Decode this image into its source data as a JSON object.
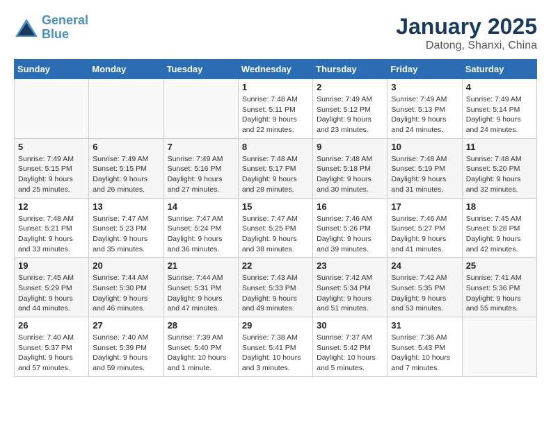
{
  "header": {
    "logo_line1": "General",
    "logo_line2": "Blue",
    "title": "January 2025",
    "subtitle": "Datong, Shanxi, China"
  },
  "weekdays": [
    "Sunday",
    "Monday",
    "Tuesday",
    "Wednesday",
    "Thursday",
    "Friday",
    "Saturday"
  ],
  "weeks": [
    [
      {
        "day": "",
        "content": ""
      },
      {
        "day": "",
        "content": ""
      },
      {
        "day": "",
        "content": ""
      },
      {
        "day": "1",
        "content": "Sunrise: 7:48 AM\nSunset: 5:11 PM\nDaylight: 9 hours and 22 minutes."
      },
      {
        "day": "2",
        "content": "Sunrise: 7:49 AM\nSunset: 5:12 PM\nDaylight: 9 hours and 23 minutes."
      },
      {
        "day": "3",
        "content": "Sunrise: 7:49 AM\nSunset: 5:13 PM\nDaylight: 9 hours and 24 minutes."
      },
      {
        "day": "4",
        "content": "Sunrise: 7:49 AM\nSunset: 5:14 PM\nDaylight: 9 hours and 24 minutes."
      }
    ],
    [
      {
        "day": "5",
        "content": "Sunrise: 7:49 AM\nSunset: 5:15 PM\nDaylight: 9 hours and 25 minutes."
      },
      {
        "day": "6",
        "content": "Sunrise: 7:49 AM\nSunset: 5:15 PM\nDaylight: 9 hours and 26 minutes."
      },
      {
        "day": "7",
        "content": "Sunrise: 7:49 AM\nSunset: 5:16 PM\nDaylight: 9 hours and 27 minutes."
      },
      {
        "day": "8",
        "content": "Sunrise: 7:48 AM\nSunset: 5:17 PM\nDaylight: 9 hours and 28 minutes."
      },
      {
        "day": "9",
        "content": "Sunrise: 7:48 AM\nSunset: 5:18 PM\nDaylight: 9 hours and 30 minutes."
      },
      {
        "day": "10",
        "content": "Sunrise: 7:48 AM\nSunset: 5:19 PM\nDaylight: 9 hours and 31 minutes."
      },
      {
        "day": "11",
        "content": "Sunrise: 7:48 AM\nSunset: 5:20 PM\nDaylight: 9 hours and 32 minutes."
      }
    ],
    [
      {
        "day": "12",
        "content": "Sunrise: 7:48 AM\nSunset: 5:21 PM\nDaylight: 9 hours and 33 minutes."
      },
      {
        "day": "13",
        "content": "Sunrise: 7:47 AM\nSunset: 5:23 PM\nDaylight: 9 hours and 35 minutes."
      },
      {
        "day": "14",
        "content": "Sunrise: 7:47 AM\nSunset: 5:24 PM\nDaylight: 9 hours and 36 minutes."
      },
      {
        "day": "15",
        "content": "Sunrise: 7:47 AM\nSunset: 5:25 PM\nDaylight: 9 hours and 38 minutes."
      },
      {
        "day": "16",
        "content": "Sunrise: 7:46 AM\nSunset: 5:26 PM\nDaylight: 9 hours and 39 minutes."
      },
      {
        "day": "17",
        "content": "Sunrise: 7:46 AM\nSunset: 5:27 PM\nDaylight: 9 hours and 41 minutes."
      },
      {
        "day": "18",
        "content": "Sunrise: 7:45 AM\nSunset: 5:28 PM\nDaylight: 9 hours and 42 minutes."
      }
    ],
    [
      {
        "day": "19",
        "content": "Sunrise: 7:45 AM\nSunset: 5:29 PM\nDaylight: 9 hours and 44 minutes."
      },
      {
        "day": "20",
        "content": "Sunrise: 7:44 AM\nSunset: 5:30 PM\nDaylight: 9 hours and 46 minutes."
      },
      {
        "day": "21",
        "content": "Sunrise: 7:44 AM\nSunset: 5:31 PM\nDaylight: 9 hours and 47 minutes."
      },
      {
        "day": "22",
        "content": "Sunrise: 7:43 AM\nSunset: 5:33 PM\nDaylight: 9 hours and 49 minutes."
      },
      {
        "day": "23",
        "content": "Sunrise: 7:42 AM\nSunset: 5:34 PM\nDaylight: 9 hours and 51 minutes."
      },
      {
        "day": "24",
        "content": "Sunrise: 7:42 AM\nSunset: 5:35 PM\nDaylight: 9 hours and 53 minutes."
      },
      {
        "day": "25",
        "content": "Sunrise: 7:41 AM\nSunset: 5:36 PM\nDaylight: 9 hours and 55 minutes."
      }
    ],
    [
      {
        "day": "26",
        "content": "Sunrise: 7:40 AM\nSunset: 5:37 PM\nDaylight: 9 hours and 57 minutes."
      },
      {
        "day": "27",
        "content": "Sunrise: 7:40 AM\nSunset: 5:39 PM\nDaylight: 9 hours and 59 minutes."
      },
      {
        "day": "28",
        "content": "Sunrise: 7:39 AM\nSunset: 5:40 PM\nDaylight: 10 hours and 1 minute."
      },
      {
        "day": "29",
        "content": "Sunrise: 7:38 AM\nSunset: 5:41 PM\nDaylight: 10 hours and 3 minutes."
      },
      {
        "day": "30",
        "content": "Sunrise: 7:37 AM\nSunset: 5:42 PM\nDaylight: 10 hours and 5 minutes."
      },
      {
        "day": "31",
        "content": "Sunrise: 7:36 AM\nSunset: 5:43 PM\nDaylight: 10 hours and 7 minutes."
      },
      {
        "day": "",
        "content": ""
      }
    ]
  ]
}
